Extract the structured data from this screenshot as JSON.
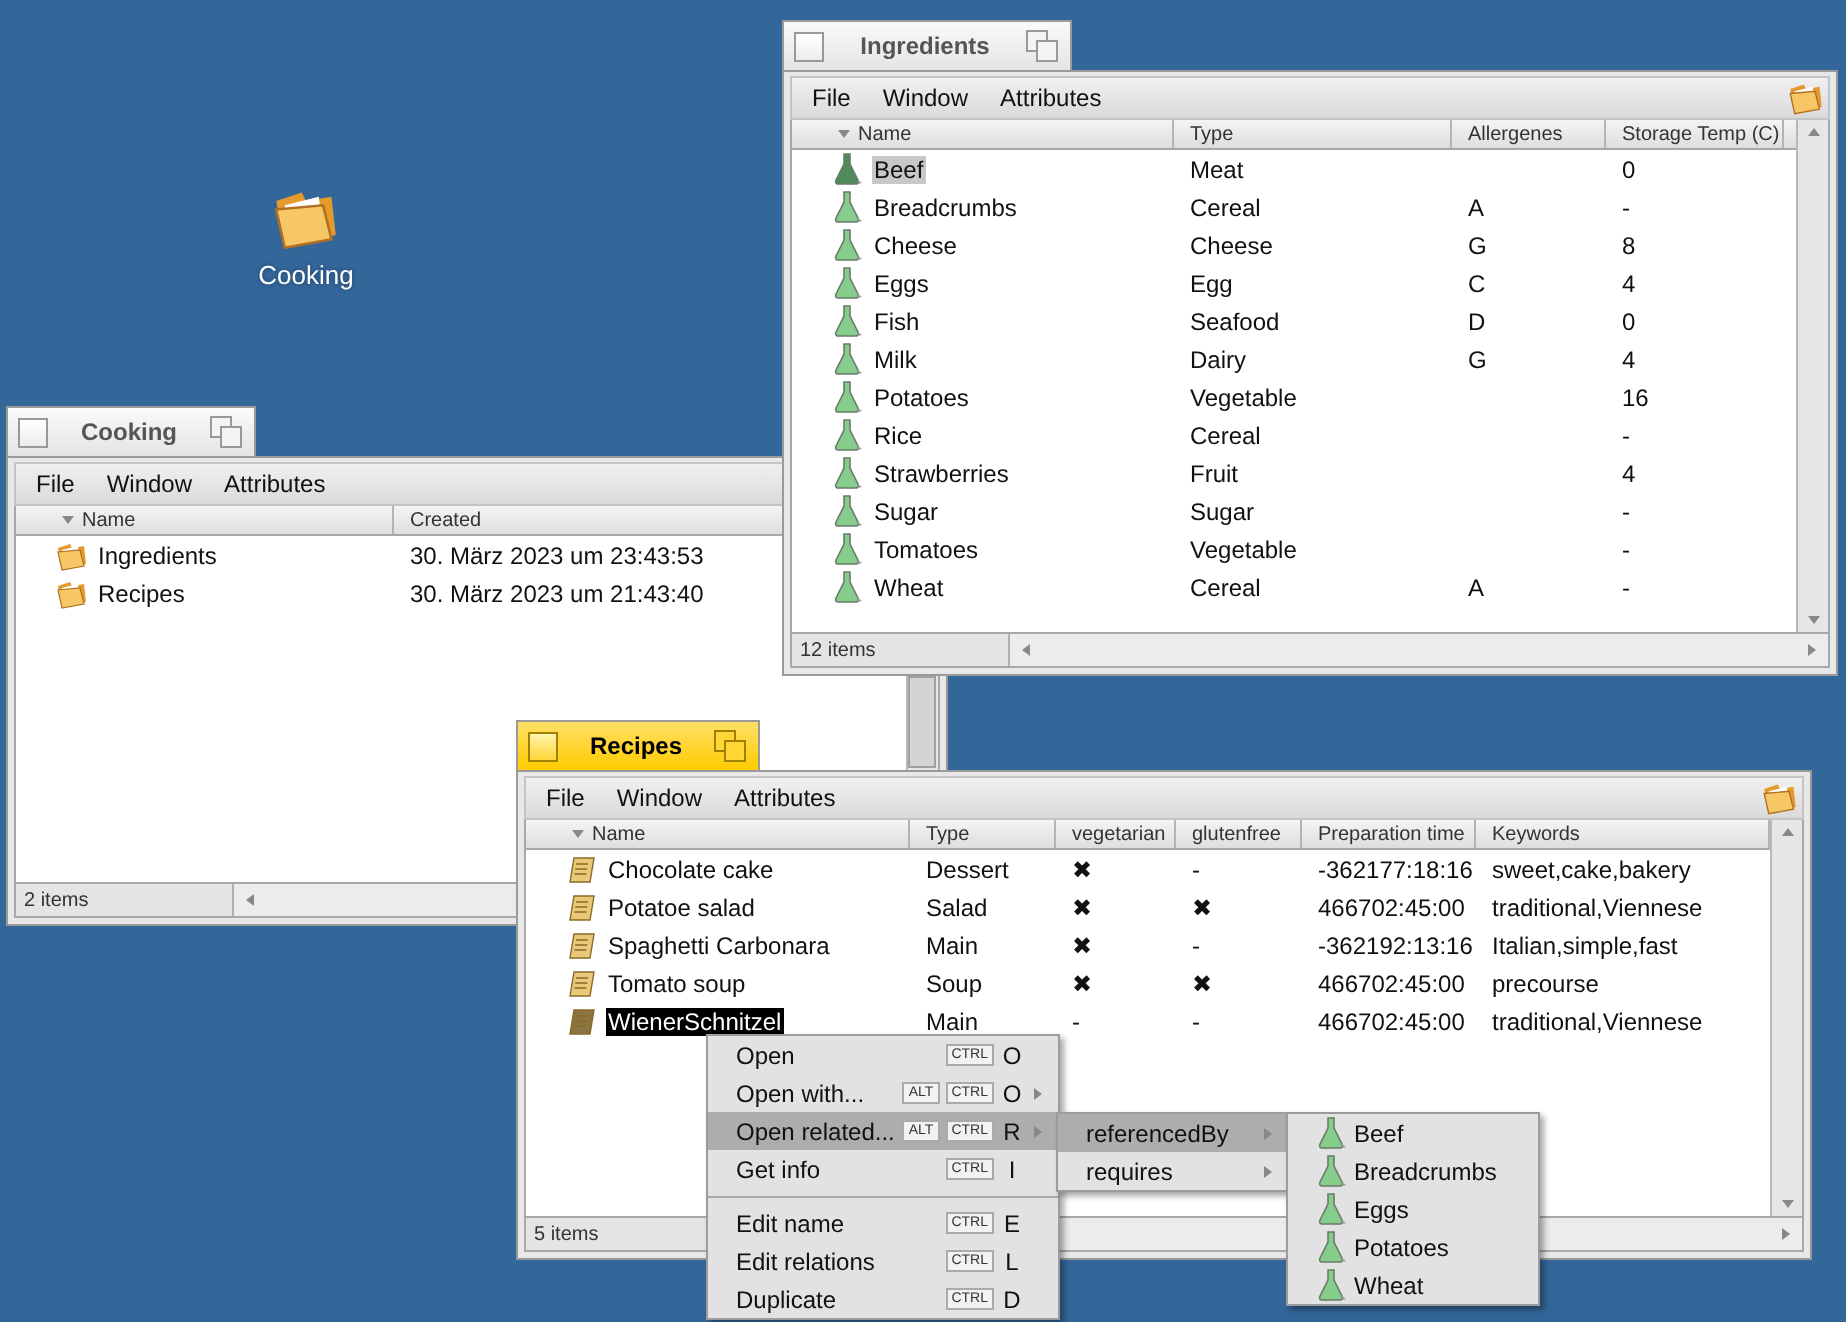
{
  "desktop_icons": [
    {
      "label": "Cooking"
    }
  ],
  "windows": [
    {
      "title": "Cooking",
      "active": false,
      "menu": [
        "File",
        "Window",
        "Attributes"
      ],
      "columns": [
        {
          "label": "Name",
          "sorted": true
        },
        {
          "label": "Created",
          "sorted": false
        }
      ],
      "rows": [
        {
          "kind": "folder",
          "selected": false,
          "cells": [
            "Ingredients",
            "30. März 2023 um 23:43:53"
          ]
        },
        {
          "kind": "folder",
          "selected": false,
          "cells": [
            "Recipes",
            "30. März 2023 um 21:43:40"
          ]
        }
      ],
      "status": "2 items"
    },
    {
      "title": "Ingredients",
      "active": false,
      "menu": [
        "File",
        "Window",
        "Attributes"
      ],
      "columns": [
        {
          "label": "Name",
          "sorted": true
        },
        {
          "label": "Type",
          "sorted": false
        },
        {
          "label": "Allergenes",
          "sorted": false
        },
        {
          "label": "Storage Temp (C)",
          "sorted": false
        }
      ],
      "rows": [
        {
          "kind": "flask",
          "selected": true,
          "cells": [
            "Beef",
            "Meat",
            "",
            "0"
          ]
        },
        {
          "kind": "flask",
          "selected": false,
          "cells": [
            "Breadcrumbs",
            "Cereal",
            "A",
            "-"
          ]
        },
        {
          "kind": "flask",
          "selected": false,
          "cells": [
            "Cheese",
            "Cheese",
            "G",
            "8"
          ]
        },
        {
          "kind": "flask",
          "selected": false,
          "cells": [
            "Eggs",
            "Egg",
            "C",
            "4"
          ]
        },
        {
          "kind": "flask",
          "selected": false,
          "cells": [
            "Fish",
            "Seafood",
            "D",
            "0"
          ]
        },
        {
          "kind": "flask",
          "selected": false,
          "cells": [
            "Milk",
            "Dairy",
            "G",
            "4"
          ]
        },
        {
          "kind": "flask",
          "selected": false,
          "cells": [
            "Potatoes",
            "Vegetable",
            "",
            "16"
          ]
        },
        {
          "kind": "flask",
          "selected": false,
          "cells": [
            "Rice",
            "Cereal",
            "",
            "-"
          ]
        },
        {
          "kind": "flask",
          "selected": false,
          "cells": [
            "Strawberries",
            "Fruit",
            "",
            "4"
          ]
        },
        {
          "kind": "flask",
          "selected": false,
          "cells": [
            "Sugar",
            "Sugar",
            "",
            "-"
          ]
        },
        {
          "kind": "flask",
          "selected": false,
          "cells": [
            "Tomatoes",
            "Vegetable",
            "",
            "-"
          ]
        },
        {
          "kind": "flask",
          "selected": false,
          "cells": [
            "Wheat",
            "Cereal",
            "A",
            "-"
          ]
        }
      ],
      "status": "12 items"
    },
    {
      "title": "Recipes",
      "active": true,
      "menu": [
        "File",
        "Window",
        "Attributes"
      ],
      "columns": [
        {
          "label": "Name",
          "sorted": true
        },
        {
          "label": "Type",
          "sorted": false
        },
        {
          "label": "vegetarian",
          "sorted": false
        },
        {
          "label": "glutenfree",
          "sorted": false
        },
        {
          "label": "Preparation time",
          "sorted": false
        },
        {
          "label": "Keywords",
          "sorted": false
        }
      ],
      "rows": [
        {
          "kind": "recipe",
          "selected": false,
          "cells": [
            "Chocolate cake",
            "Dessert",
            "✖",
            "-",
            "-362177:18:16",
            "sweet,cake,bakery"
          ]
        },
        {
          "kind": "recipe",
          "selected": false,
          "cells": [
            "Potatoe salad",
            "Salad",
            "✖",
            "✖",
            "466702:45:00",
            "traditional,Viennese"
          ]
        },
        {
          "kind": "recipe",
          "selected": false,
          "cells": [
            "Spaghetti Carbonara",
            "Main",
            "✖",
            "-",
            "-362192:13:16",
            "Italian,simple,fast"
          ]
        },
        {
          "kind": "recipe",
          "selected": false,
          "cells": [
            "Tomato soup",
            "Soup",
            "✖",
            "✖",
            "466702:45:00",
            "precourse"
          ]
        },
        {
          "kind": "recipe",
          "selected": true,
          "cells": [
            "WienerSchnitzel",
            "Main",
            "-",
            "-",
            "466702:45:00",
            "traditional,Viennese"
          ]
        }
      ],
      "status": "5 items"
    }
  ],
  "menus": [
    {
      "items": [
        {
          "kind": "item",
          "label": "Open",
          "modifiers": [
            "CTRL"
          ],
          "key": "O",
          "submenu": false,
          "highlighted": false
        },
        {
          "kind": "item",
          "label": "Open with...",
          "modifiers": [
            "ALT",
            "CTRL"
          ],
          "key": "O",
          "submenu": true,
          "highlighted": false
        },
        {
          "kind": "item",
          "label": "Open related...",
          "modifiers": [
            "ALT",
            "CTRL"
          ],
          "key": "R",
          "submenu": true,
          "highlighted": true
        },
        {
          "kind": "item",
          "label": "Get info",
          "modifiers": [
            "CTRL"
          ],
          "key": "I",
          "submenu": false,
          "highlighted": false
        },
        {
          "kind": "separator"
        },
        {
          "kind": "item",
          "label": "Edit name",
          "modifiers": [
            "CTRL"
          ],
          "key": "E",
          "submenu": false,
          "highlighted": false
        },
        {
          "kind": "item",
          "label": "Edit relations",
          "modifiers": [
            "CTRL"
          ],
          "key": "L",
          "submenu": false,
          "highlighted": false
        },
        {
          "kind": "item",
          "label": "Duplicate",
          "modifiers": [
            "CTRL"
          ],
          "key": "D",
          "submenu": false,
          "highlighted": false
        }
      ]
    },
    {
      "items": [
        {
          "kind": "item",
          "label": "referencedBy",
          "submenu": true,
          "highlighted": true
        },
        {
          "kind": "item",
          "label": "requires",
          "submenu": true,
          "highlighted": false
        }
      ]
    },
    {
      "items": [
        {
          "kind": "flask",
          "label": "Beef",
          "highlighted": false
        },
        {
          "kind": "flask",
          "label": "Breadcrumbs",
          "highlighted": false
        },
        {
          "kind": "flask",
          "label": "Eggs",
          "highlighted": false
        },
        {
          "kind": "flask",
          "label": "Potatoes",
          "highlighted": false
        },
        {
          "kind": "flask",
          "label": "Wheat",
          "highlighted": false
        }
      ]
    }
  ]
}
